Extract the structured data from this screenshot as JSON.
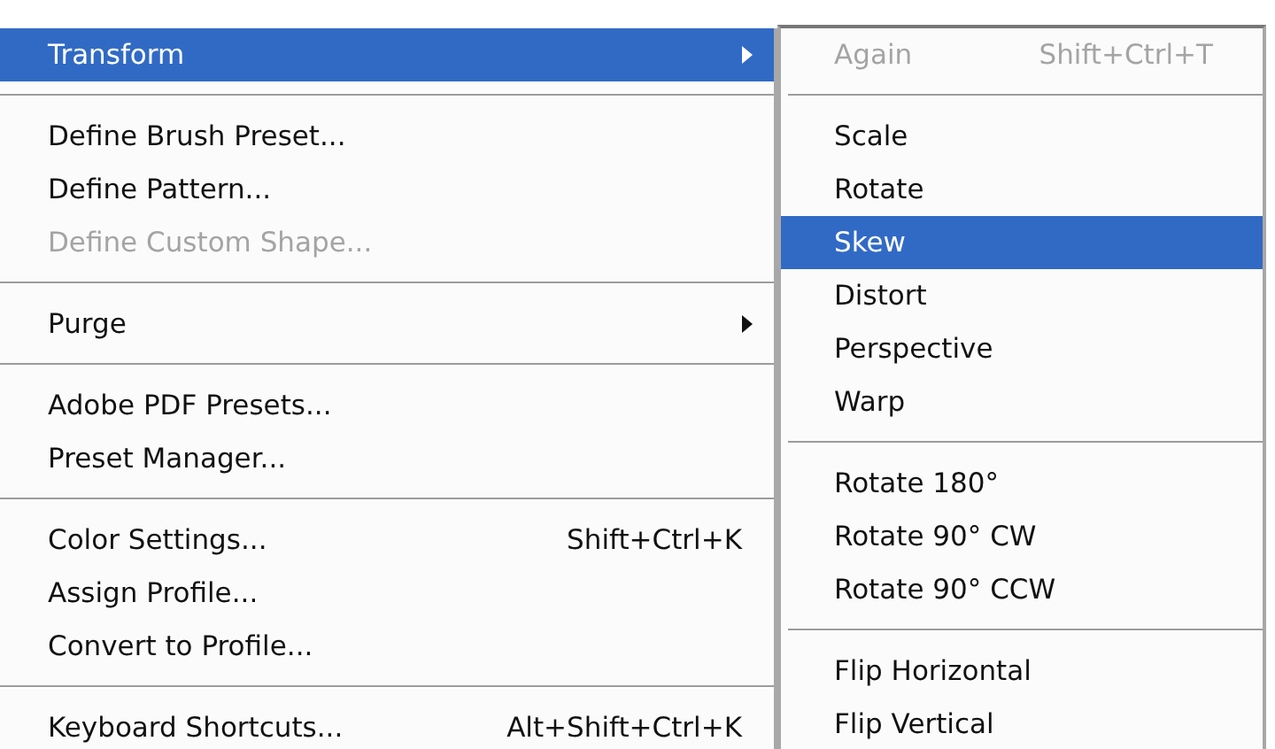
{
  "main_menu": {
    "items": [
      {
        "kind": "item",
        "label": "Transform",
        "has_submenu": true,
        "selected": true,
        "disabled": false
      },
      {
        "kind": "separator"
      },
      {
        "kind": "item",
        "label": "Define Brush Preset...",
        "has_submenu": false,
        "selected": false,
        "disabled": false
      },
      {
        "kind": "item",
        "label": "Define Pattern...",
        "has_submenu": false,
        "selected": false,
        "disabled": false
      },
      {
        "kind": "item",
        "label": "Define Custom Shape...",
        "has_submenu": false,
        "selected": false,
        "disabled": true
      },
      {
        "kind": "separator"
      },
      {
        "kind": "item",
        "label": "Purge",
        "has_submenu": true,
        "selected": false,
        "disabled": false
      },
      {
        "kind": "separator"
      },
      {
        "kind": "item",
        "label": "Adobe PDF Presets...",
        "has_submenu": false,
        "selected": false,
        "disabled": false
      },
      {
        "kind": "item",
        "label": "Preset Manager...",
        "has_submenu": false,
        "selected": false,
        "disabled": false
      },
      {
        "kind": "separator"
      },
      {
        "kind": "item",
        "label": "Color Settings...",
        "shortcut": "Shift+Ctrl+K",
        "has_submenu": false,
        "selected": false,
        "disabled": false
      },
      {
        "kind": "item",
        "label": "Assign Profile...",
        "has_submenu": false,
        "selected": false,
        "disabled": false
      },
      {
        "kind": "item",
        "label": "Convert to Profile...",
        "has_submenu": false,
        "selected": false,
        "disabled": false
      },
      {
        "kind": "separator"
      },
      {
        "kind": "item",
        "label": "Keyboard Shortcuts...",
        "shortcut": "Alt+Shift+Ctrl+K",
        "has_submenu": false,
        "selected": false,
        "disabled": false
      }
    ]
  },
  "submenu": {
    "items": [
      {
        "kind": "item",
        "label": "Again",
        "shortcut": "Shift+Ctrl+T",
        "has_submenu": false,
        "selected": false,
        "disabled": true
      },
      {
        "kind": "separator"
      },
      {
        "kind": "item",
        "label": "Scale",
        "has_submenu": false,
        "selected": false,
        "disabled": false
      },
      {
        "kind": "item",
        "label": "Rotate",
        "has_submenu": false,
        "selected": false,
        "disabled": false
      },
      {
        "kind": "item",
        "label": "Skew",
        "has_submenu": false,
        "selected": true,
        "disabled": false
      },
      {
        "kind": "item",
        "label": "Distort",
        "has_submenu": false,
        "selected": false,
        "disabled": false
      },
      {
        "kind": "item",
        "label": "Perspective",
        "has_submenu": false,
        "selected": false,
        "disabled": false
      },
      {
        "kind": "item",
        "label": "Warp",
        "has_submenu": false,
        "selected": false,
        "disabled": false
      },
      {
        "kind": "separator"
      },
      {
        "kind": "item",
        "label": "Rotate 180°",
        "has_submenu": false,
        "selected": false,
        "disabled": false
      },
      {
        "kind": "item",
        "label": "Rotate 90° CW",
        "has_submenu": false,
        "selected": false,
        "disabled": false
      },
      {
        "kind": "item",
        "label": "Rotate 90° CCW",
        "has_submenu": false,
        "selected": false,
        "disabled": false
      },
      {
        "kind": "separator"
      },
      {
        "kind": "item",
        "label": "Flip Horizontal",
        "has_submenu": false,
        "selected": false,
        "disabled": false
      },
      {
        "kind": "item",
        "label": "Flip Vertical",
        "has_submenu": false,
        "selected": false,
        "disabled": false
      }
    ]
  }
}
